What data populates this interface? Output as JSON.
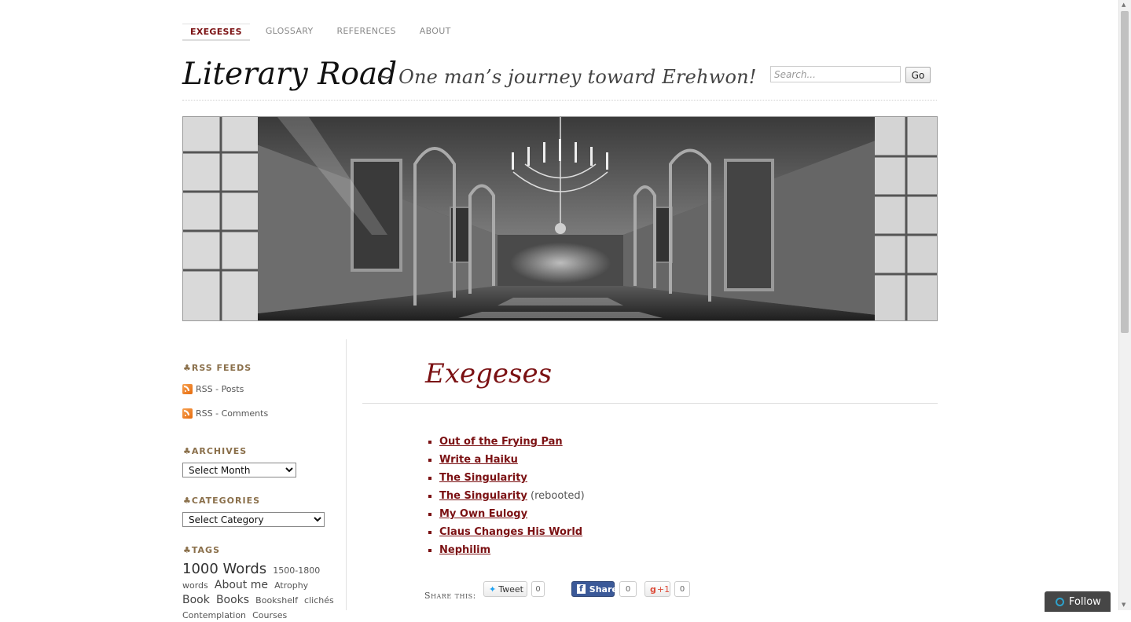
{
  "nav": [
    {
      "label": "EXEGESES",
      "active": true
    },
    {
      "label": "GLOSSARY",
      "active": false
    },
    {
      "label": "REFERENCES",
      "active": false
    },
    {
      "label": "ABOUT",
      "active": false
    }
  ],
  "header": {
    "title": "Literary Road",
    "description": "~ One man’s journey toward Erehwon!",
    "search_placeholder": "Search...",
    "search_button": "Go"
  },
  "sidebar": {
    "rss_title": "RSS FEEDS",
    "rss_posts": "RSS - Posts",
    "rss_comments": "RSS - Comments",
    "archives_title": "ARCHIVES",
    "archives_select": "Select Month",
    "categories_title": "CATEGORIES",
    "categories_select": "Select Category",
    "tags_title": "TAGS",
    "tags": [
      "1000 Words",
      "1500-1800 words",
      "About me",
      "Atrophy",
      "Book",
      "Books",
      "Bookshelf",
      "clichés",
      "Contemplation",
      "Courses"
    ]
  },
  "main": {
    "title": "Exegeses",
    "posts": [
      {
        "title": "Out of the Frying Pan",
        "note": ""
      },
      {
        "title": "Write a Haiku",
        "note": ""
      },
      {
        "title": "The Singularity",
        "note": ""
      },
      {
        "title": "The Singularity",
        "note": "(rebooted)"
      },
      {
        "title": "My Own Eulogy",
        "note": ""
      },
      {
        "title": "Claus Changes His World",
        "note": ""
      },
      {
        "title": "Nephilim",
        "note": ""
      }
    ],
    "share_label": "Share this:",
    "tweet_label": "Tweet",
    "tweet_count": "0",
    "fb_label": "Share",
    "fb_count": "0",
    "gplus_label": "+1",
    "gplus_count": "0"
  },
  "follow_label": "Follow",
  "colors": {
    "accent": "#7b1113",
    "widget_title": "#8a6f4a",
    "facebook": "#3b5998"
  }
}
